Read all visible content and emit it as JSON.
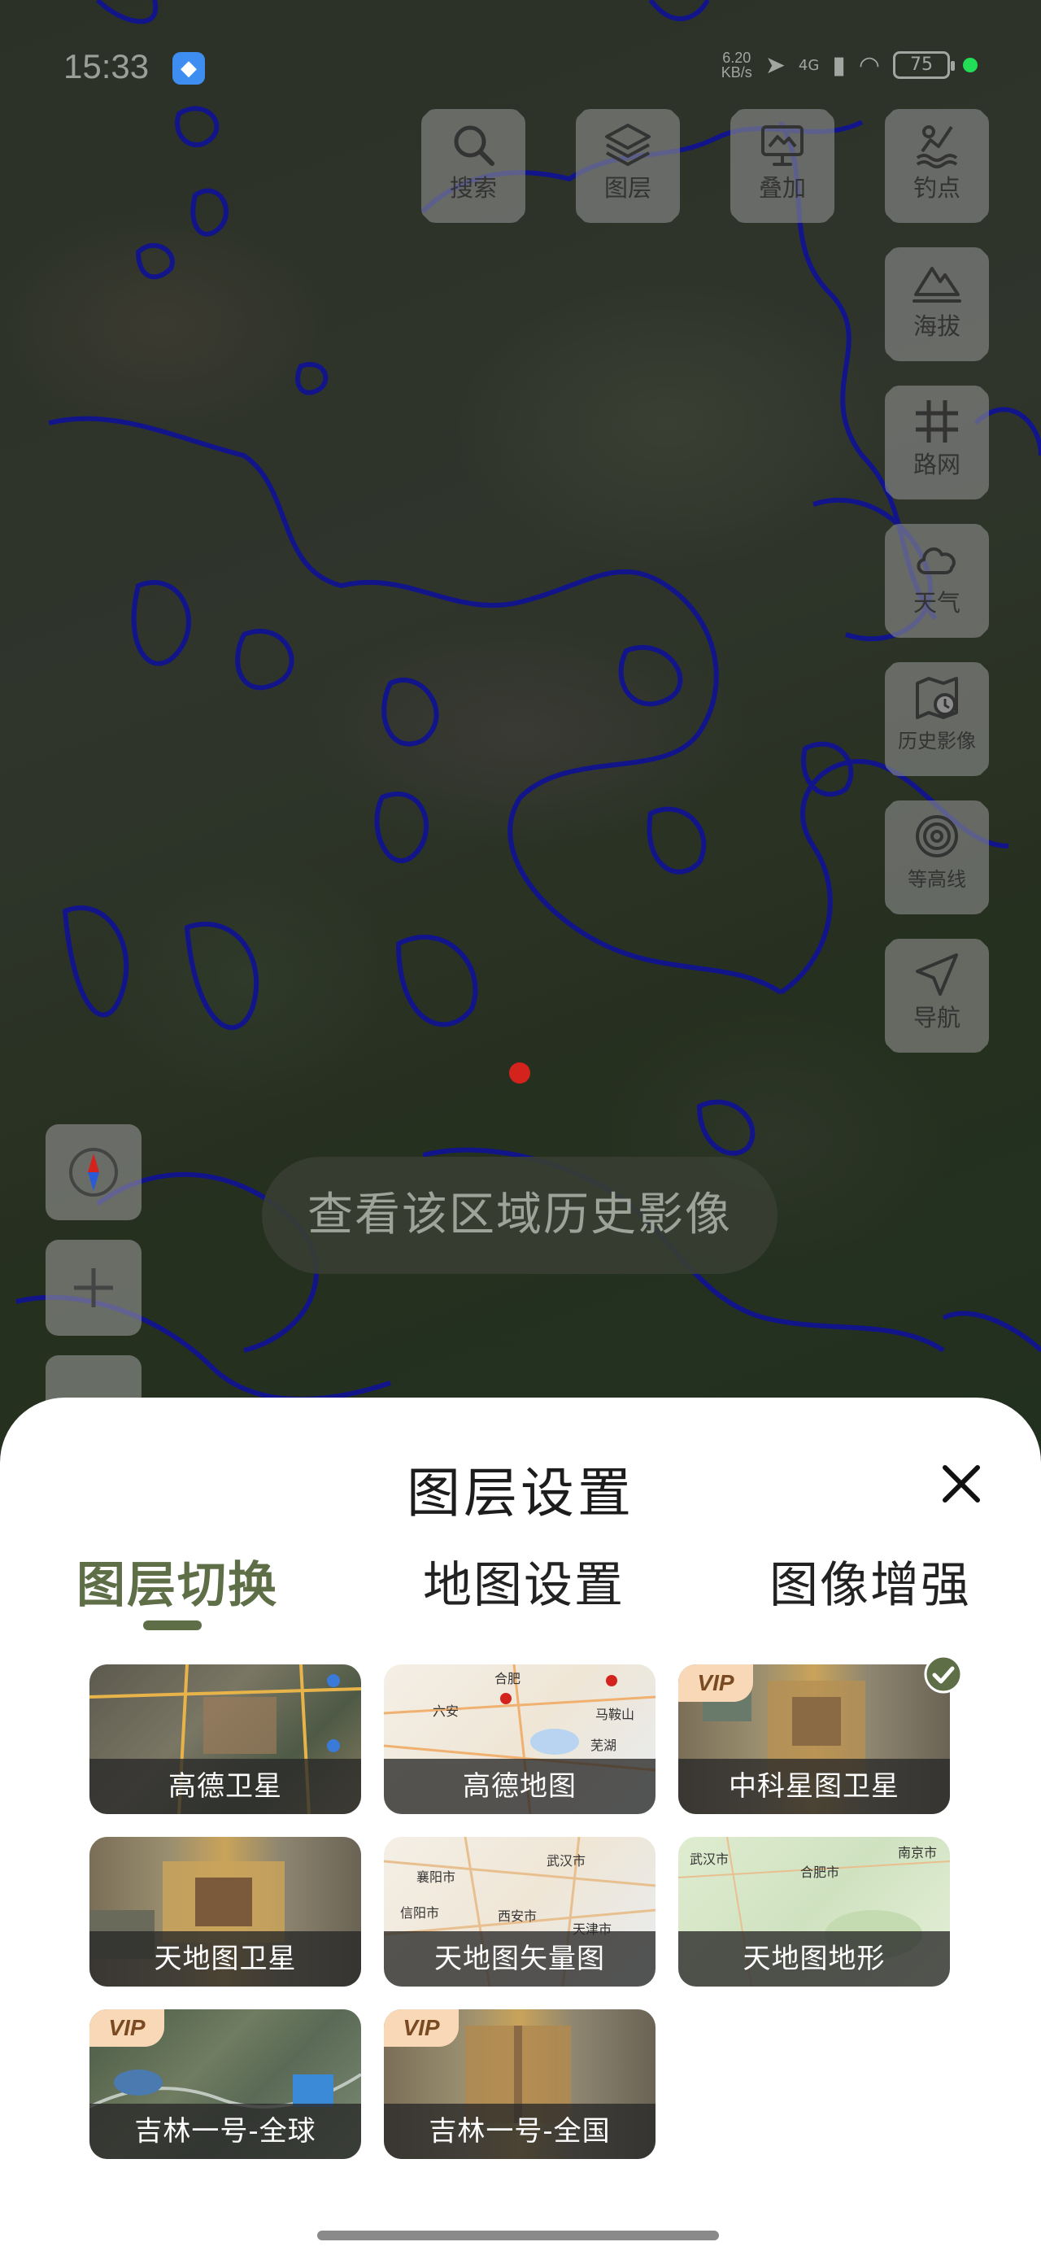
{
  "status_bar": {
    "time": "15:33",
    "speed_value": "6.20",
    "speed_unit": "KB/s",
    "network": "4G",
    "battery": "75"
  },
  "tools": [
    {
      "key": "search",
      "label": "搜索",
      "icon": "search-icon"
    },
    {
      "key": "layers",
      "label": "图层",
      "icon": "layers-icon"
    },
    {
      "key": "overlay",
      "label": "叠加",
      "icon": "overlay-icon"
    },
    {
      "key": "fishing",
      "label": "钓点",
      "icon": "fishing-icon"
    },
    {
      "key": "elevation",
      "label": "海拔",
      "icon": "mountain-icon"
    },
    {
      "key": "roads",
      "label": "路网",
      "icon": "grid-icon"
    },
    {
      "key": "weather",
      "label": "天气",
      "icon": "cloud-icon"
    },
    {
      "key": "history",
      "label": "历史影像",
      "icon": "history-map-icon"
    },
    {
      "key": "contour",
      "label": "等高线",
      "icon": "contour-icon"
    },
    {
      "key": "navigate",
      "label": "导航",
      "icon": "navigation-icon"
    }
  ],
  "map": {
    "history_prompt": "查看该区域历史影像",
    "compass_icon": "compass-icon",
    "zoom_in_icon": "plus-icon"
  },
  "sheet": {
    "title": "图层设置",
    "tabs": [
      "图层切换",
      "地图设置",
      "图像增强"
    ],
    "active_tab": 0,
    "vip_label": "VIP",
    "layers": [
      {
        "name": "高德卫星",
        "vip": false,
        "selected": false
      },
      {
        "name": "高德地图",
        "vip": false,
        "selected": false
      },
      {
        "name": "中科星图卫星",
        "vip": true,
        "selected": true
      },
      {
        "name": "天地图卫星",
        "vip": false,
        "selected": false
      },
      {
        "name": "天地图矢量图",
        "vip": false,
        "selected": false
      },
      {
        "name": "天地图地形",
        "vip": false,
        "selected": false
      },
      {
        "name": "吉林一号-全球",
        "vip": true,
        "selected": false
      },
      {
        "name": "吉林一号-全国",
        "vip": true,
        "selected": false
      }
    ],
    "map_thumb_labels": {
      "gaode_map": [
        "合肥",
        "六安",
        "马鞍山",
        "芜湖"
      ],
      "tianditu_vector": [
        "武汉市",
        "襄阳市",
        "信阳市",
        "西安市",
        "天津市"
      ],
      "tianditu_terrain": [
        "合肥市",
        "南京市",
        "武汉市"
      ]
    }
  },
  "colors": {
    "accent": "#5e6e46",
    "contour": "#12158a",
    "marker": "#d3231c",
    "vip_badge": "#f8d8b6"
  }
}
